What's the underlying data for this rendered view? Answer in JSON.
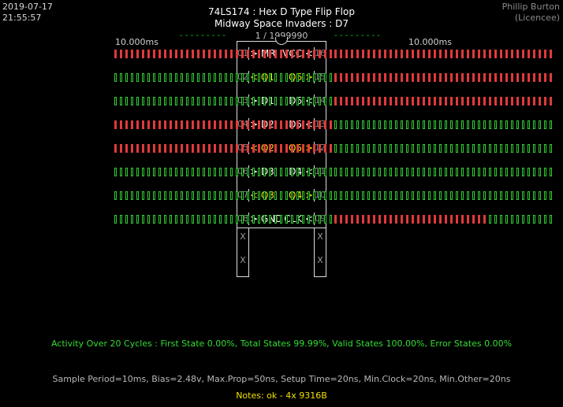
{
  "header": {
    "date": "2019-07-17",
    "time": "21:55:57",
    "author_name": "Phillip Burton",
    "author_role": "(Licencee)",
    "title_line1": "74LS174 :  Hex D Type Flip Flop",
    "title_line2": "Midway Space Invaders : D7",
    "counter": "1 / 1999990",
    "left_time_label": "10.000ms",
    "right_time_label": "10.000ms",
    "left_dashes": "- - - - - - - - -",
    "right_dashes": "- - - - - - - - -"
  },
  "colors": {
    "high": "#e03a3a",
    "low": "#33cc33",
    "input_label": "#ffffff",
    "output_label": "#f0e000"
  },
  "pins_left": [
    {
      "num": "01",
      "label": "> MR",
      "kind": "input",
      "trace": "HHHHHHHHHHHHHHHHHHHH"
    },
    {
      "num": "02",
      "label": "< Q1",
      "kind": "output",
      "trace": "LLLLLLLLLLLLLLLLLLLL"
    },
    {
      "num": "03",
      "label": "> D1",
      "kind": "input",
      "trace": "LLLLLLLLLLLLLLLLLLLL"
    },
    {
      "num": "04",
      "label": "> D2",
      "kind": "input",
      "trace": "HHHHHHHHHHHHHHHHHHHH"
    },
    {
      "num": "05",
      "label": "< Q2",
      "kind": "output",
      "trace": "HHHHHHHHHHHHHHHHHHHH"
    },
    {
      "num": "06",
      "label": "> D3",
      "kind": "input",
      "trace": "LLLLLLLLLLLLLLLLLLLL"
    },
    {
      "num": "07",
      "label": "< Q3",
      "kind": "output",
      "trace": "LLLLLLLLLLLLLLLLLLLL"
    },
    {
      "num": "08",
      "label": "> GND",
      "kind": "input",
      "trace": "LLLLLLLLLLLLLLLLLLLL"
    }
  ],
  "pins_right": [
    {
      "num": "16",
      "label": "VCC <",
      "kind": "input",
      "trace": "HHHHHHHHHHHHHHHHHHHH"
    },
    {
      "num": "15",
      "label": "Q6 >",
      "kind": "output",
      "trace": "HHHHHHHHHHHHHHHHHHHH"
    },
    {
      "num": "14",
      "label": "D6 <",
      "kind": "input",
      "trace": "HHHHHHHHHHHHHHHHHHHH"
    },
    {
      "num": "13",
      "label": "D5 <",
      "kind": "input",
      "trace": "LLLLLLLLLLLLLLLLLLLL"
    },
    {
      "num": "12",
      "label": "Q5 >",
      "kind": "output",
      "trace": "LLLLLLLLLLLLLLLLLLLL"
    },
    {
      "num": "11",
      "label": "D4 <",
      "kind": "input",
      "trace": "LLLLLLLLLLLLLLLLLLLL"
    },
    {
      "num": "10",
      "label": "Q4 >",
      "kind": "output",
      "trace": "LLLLLLLLLLLLLLLLLLLL"
    },
    {
      "num": "09",
      "label": "CLK <",
      "kind": "input",
      "trace": "HHHHHHHHHHHHHHLLLLLL"
    }
  ],
  "extra_legs": {
    "left": [
      "X",
      "X"
    ],
    "right": [
      "X",
      "X"
    ]
  },
  "footer": {
    "activity": "Activity Over 20 Cycles  :  First State 0.00%,  Total States 99.99%,  Valid States 100.00%,  Error States 0.00%",
    "sample": "Sample Period=10ms,  Bias=2.48v,  Max.Prop=50ns,  Setup Time=20ns,  Min.Clock=20ns,  Min.Other=20ns",
    "notes": "Notes:  ok - 4x 9316B"
  }
}
